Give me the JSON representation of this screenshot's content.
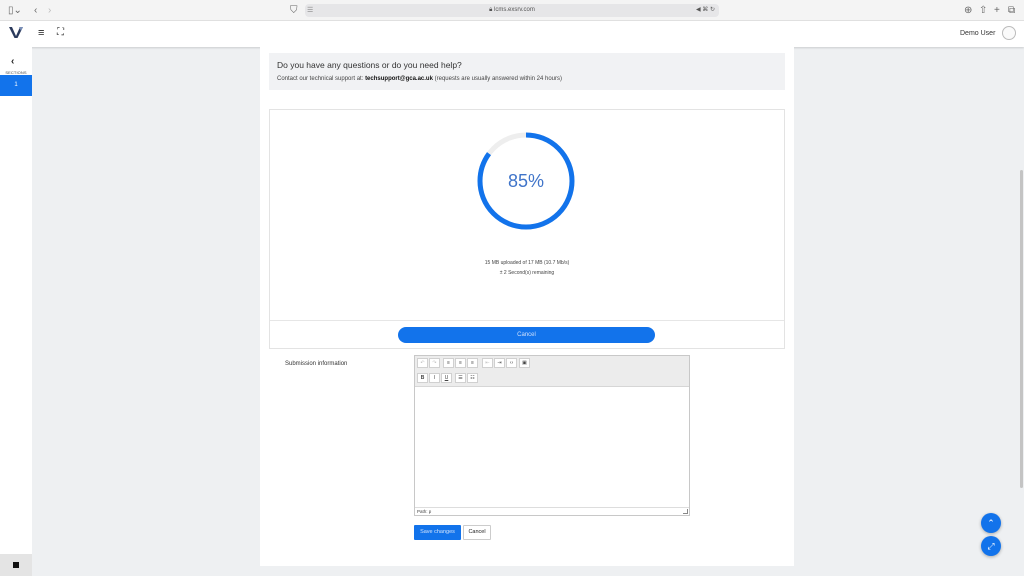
{
  "browser": {
    "url": "lcms.exsrv.com",
    "icons": [
      "sidebar-toggle-icon",
      "back-icon",
      "forward-icon",
      "shield-icon",
      "reader-icon",
      "lock-icon",
      "speaker-icon",
      "translate-icon",
      "reload-icon",
      "download-icon",
      "share-icon",
      "new-tab-icon",
      "tabs-icon"
    ]
  },
  "header": {
    "user_name": "Demo User"
  },
  "sidebar": {
    "label": "SECTIONS",
    "active_item": "1"
  },
  "help": {
    "title": "Do you have any questions or do you need help?",
    "text_prefix": "Contact our technical support at: ",
    "email": "techsupport@gca.ac.uk",
    "text_suffix": " (requests are usually answered within 24 hours)"
  },
  "upload": {
    "percent_label": "85%",
    "progress_fraction": 0.85,
    "status": "15 MB uploaded of 17 MB (10.7 Mb/s)",
    "remaining": "± 2 Second(s) remaining",
    "cancel_label": "Cancel"
  },
  "form": {
    "submission_label": "Submission information",
    "editor_path": "Path: p",
    "save_label": "Save changes",
    "cancel_label": "Cancel"
  },
  "colors": {
    "accent": "#1273eb",
    "track": "#eeeeee"
  }
}
